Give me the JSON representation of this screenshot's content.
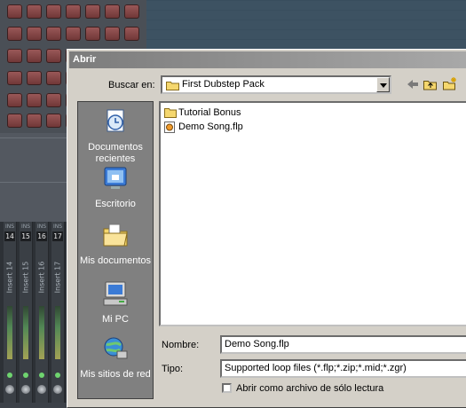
{
  "background": {
    "mixer_inserts": [
      {
        "ins": "INS",
        "number": "14",
        "label": "Insert 14"
      },
      {
        "ins": "INS",
        "number": "15",
        "label": "Insert 15"
      },
      {
        "ins": "INS",
        "number": "16",
        "label": "Insert 16"
      },
      {
        "ins": "INS",
        "number": "17",
        "label": "Insert 17"
      }
    ]
  },
  "dialog": {
    "title": "Abrir",
    "look_in_label": "Buscar en:",
    "look_in_value": "First Dubstep Pack",
    "toolbar": [
      "back-icon",
      "up-folder-icon",
      "new-folder-icon"
    ],
    "places": [
      {
        "label": "Documentos recientes",
        "icon": "recent-documents-icon"
      },
      {
        "label": "Escritorio",
        "icon": "desktop-icon"
      },
      {
        "label": "Mis documentos",
        "icon": "my-documents-icon"
      },
      {
        "label": "Mi PC",
        "icon": "my-computer-icon"
      },
      {
        "label": "Mis sitios de red",
        "icon": "network-places-icon"
      }
    ],
    "files": [
      {
        "name": "Tutorial Bonus",
        "icon": "folder-icon"
      },
      {
        "name": "Demo Song.flp",
        "icon": "flp-file-icon"
      }
    ],
    "filename_label": "Nombre:",
    "filename_value": "Demo Song.flp",
    "type_label": "Tipo:",
    "type_value": "Supported loop files (*.flp;*.zip;*.mid;*.zgr)",
    "readonly_label": "Abrir como archivo de sólo lectura",
    "readonly_checked": false
  },
  "colors": {
    "dialog_bg": "#d4d0c8",
    "titlebar": "#8a8a8a",
    "places_bg": "#808080"
  }
}
